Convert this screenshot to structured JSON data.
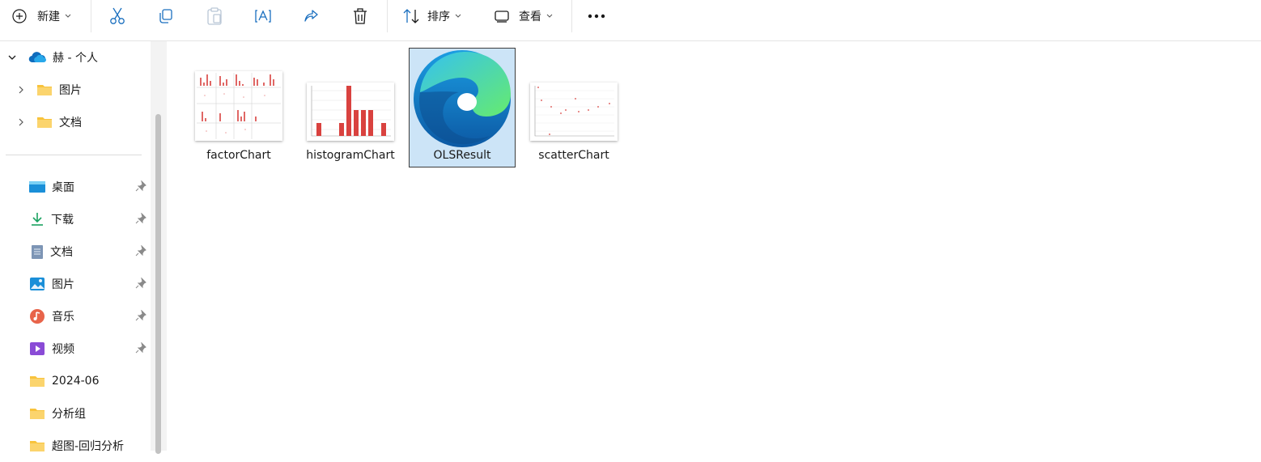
{
  "toolbar": {
    "new_label": "新建",
    "sort_label": "排序",
    "view_label": "查看"
  },
  "sidebar": {
    "tree": [
      {
        "label": "赫 - 个人",
        "icon": "cloud-icon",
        "expanded": true
      },
      {
        "label": "图片",
        "icon": "folder-icon"
      },
      {
        "label": "文档",
        "icon": "folder-icon"
      }
    ],
    "quick_access": [
      {
        "label": "桌面",
        "icon": "desktop-icon",
        "pinned": true
      },
      {
        "label": "下载",
        "icon": "download-icon",
        "pinned": true
      },
      {
        "label": "文档",
        "icon": "document-icon",
        "pinned": true
      },
      {
        "label": "图片",
        "icon": "pictures-icon",
        "pinned": true
      },
      {
        "label": "音乐",
        "icon": "music-icon",
        "pinned": true
      },
      {
        "label": "视频",
        "icon": "video-icon",
        "pinned": true
      },
      {
        "label": "2024-06",
        "icon": "folder-icon",
        "pinned": false
      },
      {
        "label": "分析组",
        "icon": "folder-icon",
        "pinned": false
      },
      {
        "label": "超图-回归分析",
        "icon": "folder-icon",
        "pinned": false
      }
    ]
  },
  "files": [
    {
      "name": "factorChart",
      "type": "image",
      "selected": false
    },
    {
      "name": "histogramChart",
      "type": "image",
      "selected": false
    },
    {
      "name": "OLSResult",
      "type": "edge-html",
      "selected": true
    },
    {
      "name": "scatterChart",
      "type": "image",
      "selected": false
    }
  ],
  "colors": {
    "accent": "#0067c0",
    "selection": "#cce4f7",
    "folder": "#f8c33c",
    "bar_red": "#d9423f"
  }
}
